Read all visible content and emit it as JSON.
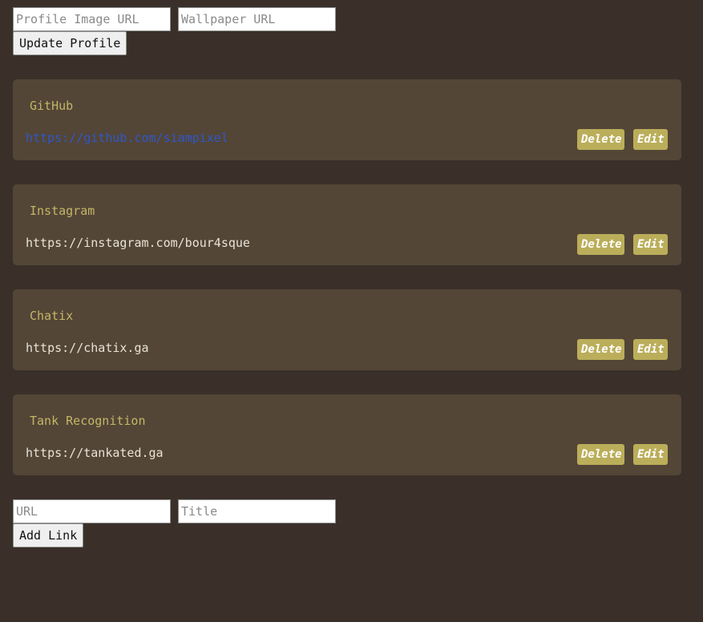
{
  "profile_form": {
    "image_url_placeholder": "Profile Image URL",
    "wallpaper_url_placeholder": "Wallpaper URL",
    "update_label": "Update Profile"
  },
  "links": [
    {
      "title": "GitHub",
      "url": "https://github.com/siampixel",
      "style": "link"
    },
    {
      "title": "Instagram",
      "url": "https://instagram.com/bour4sque",
      "style": "text"
    },
    {
      "title": "Chatix",
      "url": "https://chatix.ga",
      "style": "text"
    },
    {
      "title": "Tank Recognition",
      "url": "https://tankated.ga",
      "style": "text"
    }
  ],
  "card_actions": {
    "delete_label": "Delete",
    "edit_label": "Edit"
  },
  "add_form": {
    "url_placeholder": "URL",
    "title_placeholder": "Title",
    "add_label": "Add Link"
  },
  "colors": {
    "background": "#3a3029",
    "card": "#534637",
    "accent": "#bbae5a",
    "title": "#c3b666",
    "link": "#2f57c8"
  }
}
